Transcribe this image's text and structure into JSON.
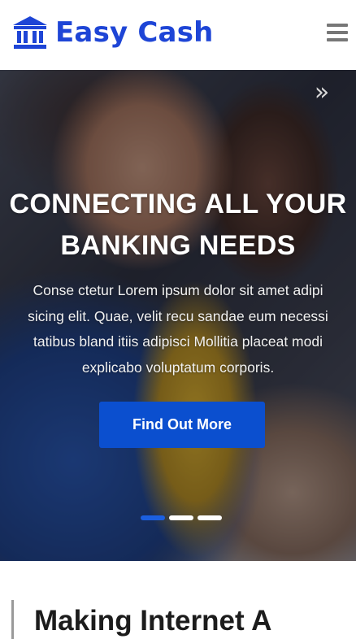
{
  "brand": {
    "name": "Easy Cash",
    "icon": "bank-icon",
    "color": "#1e45d6"
  },
  "nav": {
    "menu_icon": "hamburger-menu-icon"
  },
  "hero": {
    "next_icon": "double-chevron-right-icon",
    "next_glyph": "»",
    "title": "CONNECTING ALL YOUR BANKING NEEDS",
    "text": "Conse ctetur Lorem ipsum dolor sit amet adipi sicing elit. Quae, velit recu sandae eum necessi tatibus bland itiis adipisci Mollitia placeat modi explicabo voluptatum corporis.",
    "button_label": "Find Out More",
    "button_color": "#0b4fcf",
    "slides_total": 3,
    "active_slide": 1
  },
  "section": {
    "title": "Making Internet A"
  }
}
